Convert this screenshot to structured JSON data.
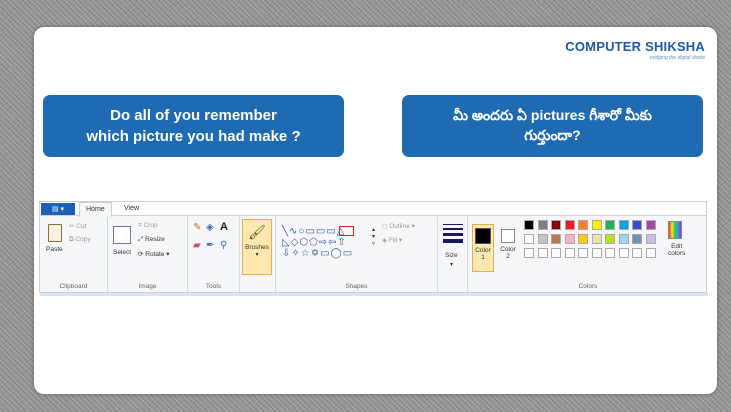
{
  "logo": {
    "name": "COMPUTER SHIKSHA",
    "tagline": "bridging the digital divide"
  },
  "question_en": {
    "line1": "Do all of you remember",
    "line2": "which picture you had make ?"
  },
  "question_te": {
    "line1": "మీ అందరు ఏ pictures గీశారో మీకు",
    "line2": "గుర్తుందా?"
  },
  "paint": {
    "tabs": {
      "home": "Home",
      "view": "View"
    },
    "clipboard": {
      "paste": "Paste",
      "cut": "Cut",
      "copy": "Copy",
      "group": "Clipboard"
    },
    "image": {
      "select": "Select",
      "crop": "Crop",
      "resize": "Resize",
      "rotate": "Rotate ▾",
      "group": "Image"
    },
    "tools": {
      "group": "Tools",
      "text_tool": "A"
    },
    "brushes": {
      "label": "Brushes"
    },
    "shapes": {
      "outline": "Outline ▾",
      "fill": "Fill ▾",
      "group": "Shapes"
    },
    "size": {
      "label": "Size"
    },
    "colors": {
      "color1": "Color",
      "color1_num": "1",
      "color2": "Color",
      "color2_num": "2",
      "edit": "Edit",
      "edit2": "colors",
      "group": "Colors",
      "palette_row1": [
        "#000000",
        "#7f7f7f",
        "#880015",
        "#ed1c24",
        "#ff7f27",
        "#fff200",
        "#22b14c",
        "#00a2e8",
        "#3f48cc",
        "#a349a4"
      ],
      "palette_row2": [
        "#ffffff",
        "#c3c3c3",
        "#b97a57",
        "#ffaec9",
        "#ffc90e",
        "#efe4b0",
        "#b5e61d",
        "#99d9ea",
        "#7092be",
        "#c8bfe7"
      ]
    }
  },
  "colors": {
    "bubble": "#1f6bb3",
    "logo": "#1f5aa6",
    "highlight": "#e02020"
  }
}
